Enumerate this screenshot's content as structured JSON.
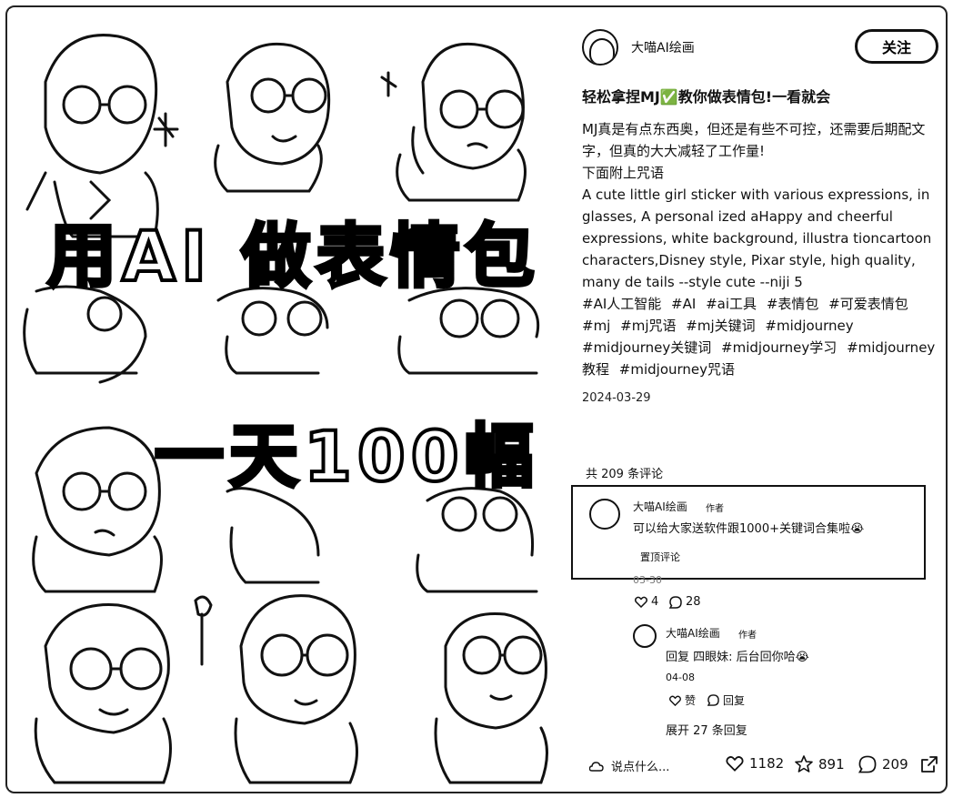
{
  "author": {
    "name": "大喵AI绘画",
    "follow_label": "关注"
  },
  "post": {
    "title": "轻松拿捏MJ✅教你做表情包!一看就会",
    "body_lines": [
      "MJ真是有点东西奥，但还是有些不可控，还需要后期配文字，但真的大大减轻了工作量!",
      "下面附上咒语",
      "A cute little girl sticker with various expressions, in glasses, A personal ized aHappy and cheerful expressions, white background, illustra tioncartoon characters,Disney style, Pixar style, high quality, many de tails --style cute --niji 5"
    ],
    "tags": [
      "#AI人工智能",
      "#AI",
      "#ai工具",
      "#表情包",
      "#可爱表情包",
      "#mj",
      "#mj咒语",
      "#mj关键词",
      "#midjourney",
      "#midjourney关键词",
      "#midjourney学习",
      "#midjourney教程",
      "#midjourney咒语"
    ],
    "date": "2024-03-29"
  },
  "image": {
    "title_line1": "用AI 做表情包",
    "title_line2": "一天100幅"
  },
  "comments": {
    "count_label": "共 209 条评论",
    "pinned": {
      "name": "大喵AI绘画",
      "badge": "作者",
      "text": "可以给大家送软件跟1000+关键词合集啦😭",
      "pin_label": "置顶评论",
      "date_partial": "03-30",
      "likes": "4",
      "replies": "28"
    },
    "reply": {
      "name": "大喵AI绘画",
      "badge": "作者",
      "text": "回复 四眼妹: 后台回你哈😭",
      "date": "04-08",
      "like_label": "赞",
      "reply_label": "回复",
      "expand_label": "展开 27 条回复"
    }
  },
  "bottom": {
    "say_placeholder": "说点什么...",
    "likes": "1182",
    "stars": "891",
    "comments": "209"
  }
}
